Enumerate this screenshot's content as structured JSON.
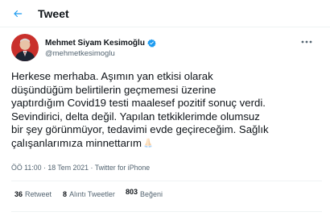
{
  "header": {
    "title": "Tweet",
    "back_icon": "arrow-left-icon"
  },
  "author": {
    "display_name": "Mehmet Siyam Kesimoğlu",
    "handle": "@mehmetkesimoglu",
    "verified": true,
    "verified_icon": "verified-badge-icon",
    "more_icon": "more-horizontal-icon"
  },
  "tweet": {
    "text": "Herkese merhaba. Aşımın yan etkisi olarak\ndüşündüğüm belirtilerin geçmemesi üzerine\nyaptırdığım Covid19 testi maalesef pozitif sonuç verdi.\nSevindirici, delta değil. Yapılan tetkiklerimde olumsuz\nbir şey görünmüyor, tedavimi evde geçireceğim. Sağlık\nçalışanlarımıza minnettarım",
    "emoji_icon": "folded-hands-emoji-icon"
  },
  "meta": {
    "time": "ÖÖ 11:00",
    "separator": "·",
    "date": "18 Tem 2021",
    "source": "Twitter for iPhone"
  },
  "stats": {
    "retweets_count": "36",
    "retweets_label": "Retweet",
    "quotes_count": "8",
    "quotes_label": "Alıntı Tweetler",
    "likes_count": "803",
    "likes_label": "Beğeni"
  },
  "colors": {
    "accent": "#1d9bf0",
    "text_primary": "#0f1419",
    "text_secondary": "#536471",
    "divider": "#eff3f4"
  }
}
